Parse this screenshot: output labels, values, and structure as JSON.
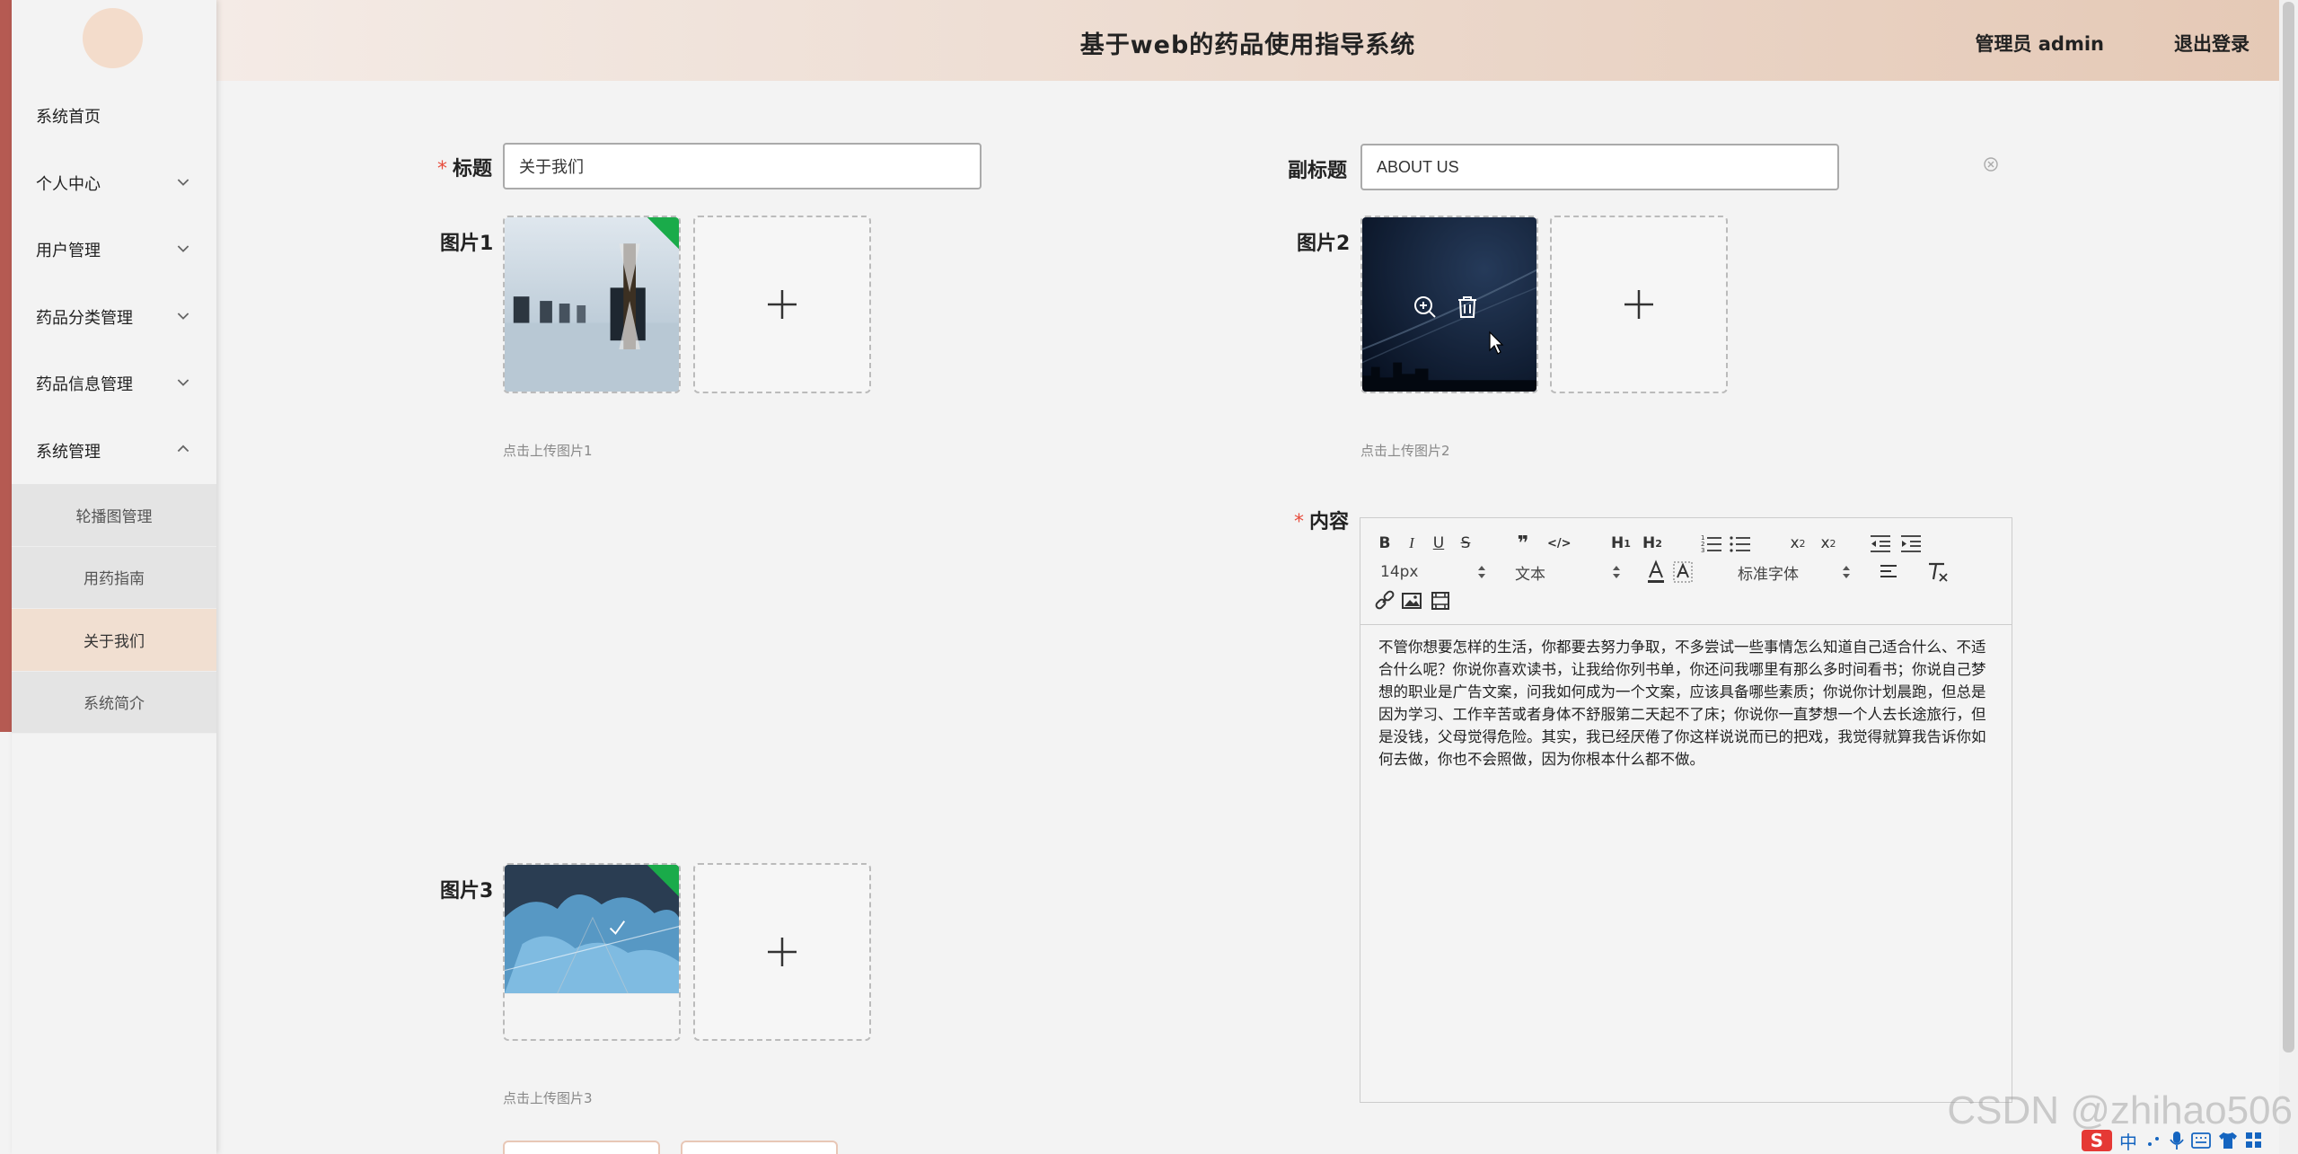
{
  "header": {
    "title": "基于web的药品使用指导系统",
    "user": "管理员 admin",
    "logout": "退出登录"
  },
  "sidebar": {
    "items": [
      {
        "label": "系统首页"
      },
      {
        "label": "个人中心"
      },
      {
        "label": "用户管理"
      },
      {
        "label": "药品分类管理"
      },
      {
        "label": "药品信息管理"
      },
      {
        "label": "系统管理"
      }
    ],
    "subitems": [
      {
        "label": "轮播图管理"
      },
      {
        "label": "用药指南"
      },
      {
        "label": "关于我们"
      },
      {
        "label": "系统简介"
      }
    ]
  },
  "form": {
    "title_label": "标题",
    "title_value": "关于我们",
    "subtitle_label": "副标题",
    "subtitle_value": "ABOUT US",
    "pic1_label": "图片1",
    "pic1_tip": "点击上传图片1",
    "pic2_label": "图片2",
    "pic2_tip": "点击上传图片2",
    "pic3_label": "图片3",
    "pic3_tip": "点击上传图片3",
    "content_label": "内容"
  },
  "editor": {
    "font_size": "14px",
    "block_type": "文本",
    "font_family": "标准字体",
    "content": "不管你想要怎样的生活，你都要去努力争取，不多尝试一些事情怎么知道自己适合什么、不适合什么呢？你说你喜欢读书，让我给你列书单，你还问我哪里有那么多时间看书；你说自己梦想的职业是广告文案，问我如何成为一个文案，应该具备哪些素质；你说你计划晨跑，但总是因为学习、工作辛苦或者身体不舒服第二天起不了床；你说你一直梦想一个人去长途旅行，但是没钱，父母觉得危险。其实，我已经厌倦了你这样说说而已的把戏，我觉得就算我告诉你如何去做，你也不会照做，因为你根本什么都不做。"
  },
  "watermark": "CSDN @zhihao506",
  "ime": {
    "s": "S",
    "lang": "中"
  },
  "colors": {
    "accent": "#b55a52",
    "required": "#e74c3c",
    "active_sub": "#f1dfd1"
  }
}
